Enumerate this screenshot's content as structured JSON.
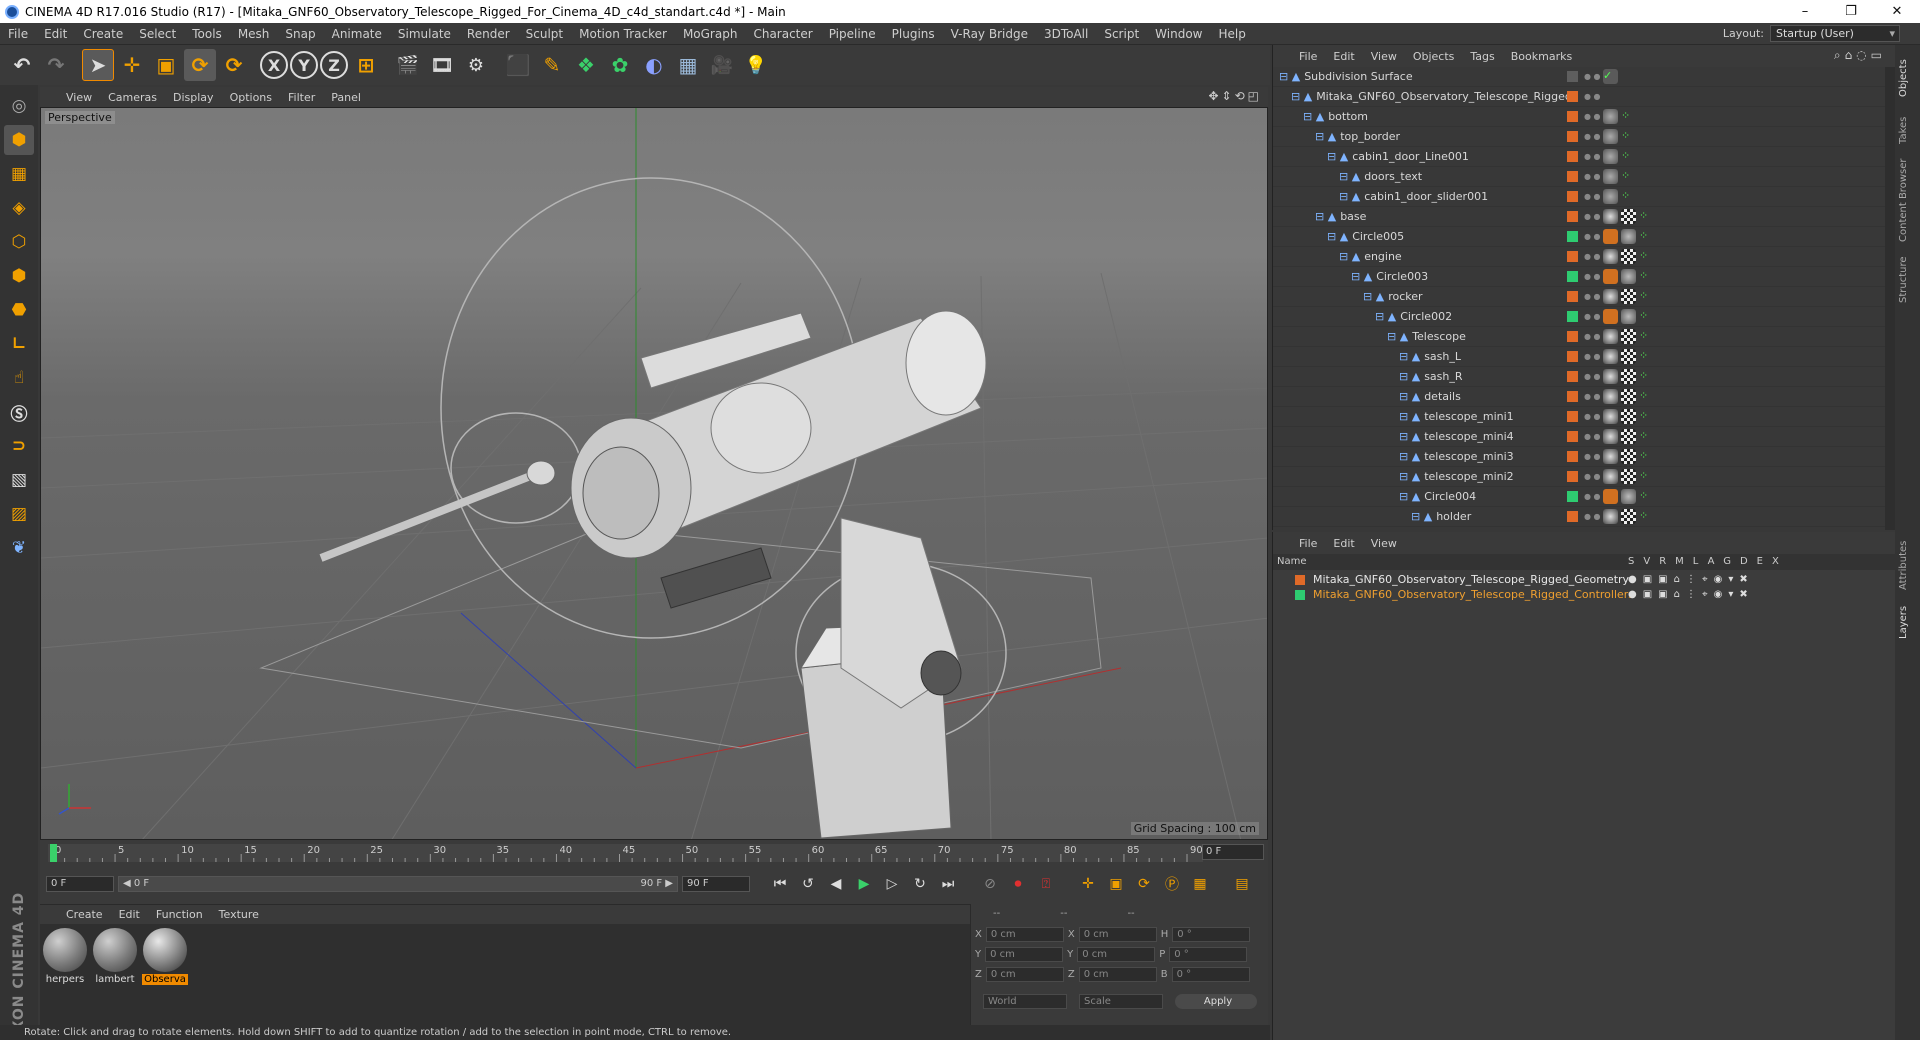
{
  "window": {
    "title": "CINEMA 4D R17.016 Studio (R17) - [Mitaka_GNF60_Observatory_Telescope_Rigged_For_Cinema_4D_c4d_standart.c4d *] - Main",
    "minimize": "–",
    "restore": "❐",
    "close": "✕"
  },
  "menubar": {
    "items": [
      "File",
      "Edit",
      "Create",
      "Select",
      "Tools",
      "Mesh",
      "Snap",
      "Animate",
      "Simulate",
      "Render",
      "Sculpt",
      "Motion Tracker",
      "MoGraph",
      "Character",
      "Pipeline",
      "Plugins",
      "V-Ray Bridge",
      "3DToAll",
      "Script",
      "Window",
      "Help"
    ],
    "layout_label": "Layout:",
    "layout_value": "Startup (User)"
  },
  "viewport": {
    "menu": [
      "View",
      "Cameras",
      "Display",
      "Options",
      "Filter",
      "Panel"
    ],
    "label": "Perspective",
    "grid_spacing": "Grid Spacing : 100 cm",
    "nav_icons": "✥⇕⟲◰"
  },
  "timeline": {
    "ticks": [
      "0",
      "5",
      "10",
      "15",
      "20",
      "25",
      "30",
      "35",
      "40",
      "45",
      "50",
      "55",
      "60",
      "65",
      "70",
      "75",
      "80",
      "85",
      "90"
    ],
    "end_frame": "0 F"
  },
  "transport": {
    "start": "0 F",
    "range_start": "◀ 0 F",
    "range_end": "90 F ▶",
    "end": "90 F"
  },
  "materials": {
    "menu": [
      "Create",
      "Edit",
      "Function",
      "Texture"
    ],
    "items": [
      {
        "name": "herpers"
      },
      {
        "name": "lambert"
      },
      {
        "name": "Observa"
      }
    ]
  },
  "coords": {
    "headers": [
      "--",
      "--",
      "--"
    ],
    "rows": [
      {
        "a": "X",
        "av": "0 cm",
        "b": "X",
        "bv": "0 cm",
        "c": "H",
        "cv": "0 °"
      },
      {
        "a": "Y",
        "av": "0 cm",
        "b": "Y",
        "bv": "0 cm",
        "c": "P",
        "cv": "0 °"
      },
      {
        "a": "Z",
        "av": "0 cm",
        "b": "Z",
        "bv": "0 cm",
        "c": "B",
        "cv": "0 °"
      }
    ],
    "mode1": "World",
    "mode2": "Scale",
    "apply": "Apply"
  },
  "status": "Rotate: Click and drag to rotate elements. Hold down SHIFT to add to quantize rotation / add to the selection in point mode, CTRL to remove.",
  "objects": {
    "menu": [
      "File",
      "Edit",
      "View",
      "Objects",
      "Tags",
      "Bookmarks"
    ],
    "icons": "⌕⌂◌▭",
    "rows": [
      {
        "name": "Subdivision Surface",
        "color": "#5e5e5e",
        "tags": "check"
      },
      {
        "name": "Mitaka_GNF60_Observatory_Telescope_Rigged",
        "color": "#e06a28",
        "tags": ""
      },
      {
        "name": "bottom",
        "color": "#e06a28",
        "tags": "b"
      },
      {
        "name": "top_border",
        "color": "#e06a28",
        "tags": "b"
      },
      {
        "name": "cabin1_door_Line001",
        "color": "#e06a28",
        "tags": "b"
      },
      {
        "name": "doors_text",
        "color": "#e06a28",
        "tags": "b"
      },
      {
        "name": "cabin1_door_slider001",
        "color": "#e06a28",
        "tags": "b"
      },
      {
        "name": "base",
        "color": "#e06a28",
        "tags": "c"
      },
      {
        "name": "Circle005",
        "color": "#2ecc71",
        "tags": "n"
      },
      {
        "name": "engine",
        "color": "#e06a28",
        "tags": "c"
      },
      {
        "name": "Circle003",
        "color": "#2ecc71",
        "tags": "n"
      },
      {
        "name": "rocker",
        "color": "#e06a28",
        "tags": "c"
      },
      {
        "name": "Circle002",
        "color": "#2ecc71",
        "tags": "n"
      },
      {
        "name": "Telescope",
        "color": "#e06a28",
        "tags": "c"
      },
      {
        "name": "sash_L",
        "color": "#e06a28",
        "tags": "c"
      },
      {
        "name": "sash_R",
        "color": "#e06a28",
        "tags": "c"
      },
      {
        "name": "details",
        "color": "#e06a28",
        "tags": "c"
      },
      {
        "name": "telescope_mini1",
        "color": "#e06a28",
        "tags": "c"
      },
      {
        "name": "telescope_mini4",
        "color": "#e06a28",
        "tags": "c"
      },
      {
        "name": "telescope_mini3",
        "color": "#e06a28",
        "tags": "c"
      },
      {
        "name": "telescope_mini2",
        "color": "#e06a28",
        "tags": "c"
      },
      {
        "name": "Circle004",
        "color": "#2ecc71",
        "tags": "n"
      },
      {
        "name": "holder",
        "color": "#e06a28",
        "tags": "c"
      }
    ]
  },
  "layers": {
    "menu": [
      "File",
      "Edit",
      "View"
    ],
    "name_header": "Name",
    "columns": "SVRMLAGDEX",
    "rows": [
      {
        "name": "Mitaka_GNF60_Observatory_Telescope_Rigged_Geometry",
        "color": "#e06a28",
        "text_color": "#e8e8e8",
        "icons": "●▣▣⌂⋮⌖◉▾✖"
      },
      {
        "name": "Mitaka_GNF60_Observatory_Telescope_Rigged_Controllers",
        "color": "#2ecc71",
        "text_color": "#f0a030",
        "icons": "●▣▣⌂⋮⌖◉▾✖"
      }
    ]
  },
  "sidetabs": [
    "Objects",
    "Takes",
    "Content Browser",
    "Structure",
    "Attributes",
    "Layers"
  ],
  "toolbar_glyphs": {
    "undo": "↶",
    "redo": "↷",
    "select": "➤",
    "move": "✛",
    "scale": "▣",
    "rotate": "⟳",
    "rotate2": "⟳",
    "x": "X",
    "y": "Y",
    "z": "Z",
    "coord": "⊞",
    "render_view": "🎬",
    "render": "🎞",
    "render_settings": "⚙",
    "cube": "⬛",
    "pen": "✎",
    "subdiv": "❖",
    "cloner": "✿",
    "deformer": "◐",
    "floor": "▦",
    "camera": "🎥",
    "light": "💡"
  }
}
